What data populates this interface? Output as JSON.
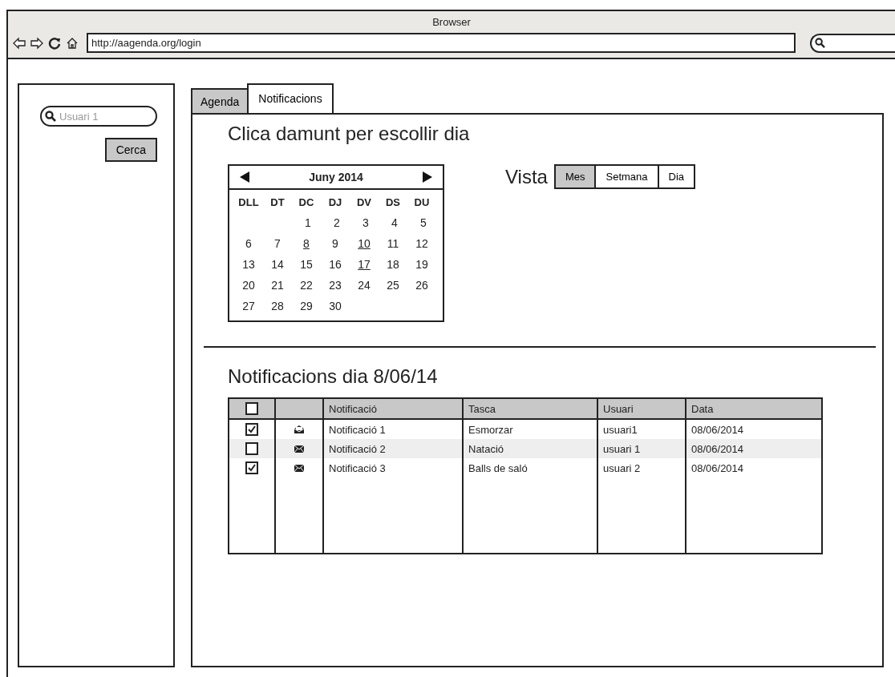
{
  "window": {
    "title": "Browser"
  },
  "toolbar": {
    "url": "http://aagenda.org/login"
  },
  "sidebar": {
    "search": {
      "placeholder": "Usuari 1"
    },
    "button": "Cerca"
  },
  "tabs": [
    {
      "label": "Agenda",
      "selected": false
    },
    {
      "label": "Notificacions",
      "selected": true
    }
  ],
  "heading": "Clica damunt per escollir dia",
  "calendar": {
    "month": "Juny 2014",
    "weekdays": [
      "DLL",
      "DT",
      "DC",
      "DJ",
      "DV",
      "DS",
      "DU"
    ],
    "weeks": [
      {
        "kind": "first",
        "days": [
          {
            "day": "1",
            "marked": false
          },
          {
            "day": "2",
            "marked": false
          },
          {
            "day": "3",
            "marked": false
          },
          {
            "day": "4",
            "marked": false
          },
          {
            "day": "5",
            "marked": false
          }
        ]
      },
      {
        "kind": "full",
        "days": [
          {
            "day": "6",
            "marked": false
          },
          {
            "day": "7",
            "marked": false
          },
          {
            "day": "8",
            "marked": true
          },
          {
            "day": "9",
            "marked": false
          },
          {
            "day": "10",
            "marked": true
          },
          {
            "day": "11",
            "marked": false
          },
          {
            "day": "12",
            "marked": false
          }
        ]
      },
      {
        "kind": "full",
        "days": [
          {
            "day": "13",
            "marked": false
          },
          {
            "day": "14",
            "marked": false
          },
          {
            "day": "15",
            "marked": false
          },
          {
            "day": "16",
            "marked": false
          },
          {
            "day": "17",
            "marked": true
          },
          {
            "day": "18",
            "marked": false
          },
          {
            "day": "19",
            "marked": false
          }
        ]
      },
      {
        "kind": "full",
        "days": [
          {
            "day": "20",
            "marked": false
          },
          {
            "day": "21",
            "marked": false
          },
          {
            "day": "22",
            "marked": false
          },
          {
            "day": "23",
            "marked": false
          },
          {
            "day": "24",
            "marked": false
          },
          {
            "day": "25",
            "marked": false
          },
          {
            "day": "26",
            "marked": false
          }
        ]
      },
      {
        "kind": "last",
        "days": [
          {
            "day": "27",
            "marked": false
          },
          {
            "day": "28",
            "marked": false
          },
          {
            "day": "29",
            "marked": false
          },
          {
            "day": "30",
            "marked": false
          }
        ]
      }
    ]
  },
  "view": {
    "label": "Vista",
    "options": [
      {
        "label": "Mes",
        "selected": true
      },
      {
        "label": "Setmana",
        "selected": false
      },
      {
        "label": "Dia",
        "selected": false
      }
    ]
  },
  "notifications": {
    "title": "Notificacions  dia 8/06/14",
    "header_checked": false,
    "columns": [
      "Notificació",
      "Tasca",
      "Usuari",
      "Data"
    ],
    "rows": [
      {
        "checked": true,
        "read": true,
        "cells": [
          "Notificació 1",
          "Esmorzar",
          "usuari1",
          "08/06/2014"
        ]
      },
      {
        "checked": false,
        "read": false,
        "cells": [
          "Notificació 2",
          "Natació",
          "usuari 1",
          "08/06/2014"
        ]
      },
      {
        "checked": true,
        "read": false,
        "cells": [
          "Notificació 3",
          "Balls de saló",
          "usuari 2",
          "08/06/2014"
        ]
      }
    ]
  }
}
